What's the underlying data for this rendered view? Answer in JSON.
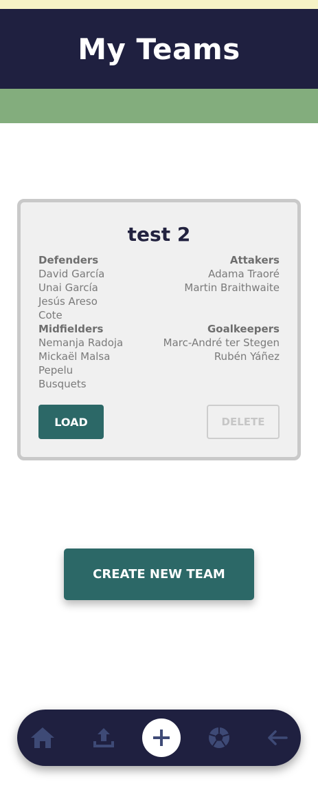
{
  "header": {
    "title": "My Teams"
  },
  "team": {
    "name": "test 2",
    "positions": {
      "defenders": {
        "title": "Defenders",
        "players": [
          "David García",
          "Unai García",
          "Jesús Areso",
          "Cote"
        ]
      },
      "midfielders": {
        "title": "Midfielders",
        "players": [
          "Nemanja Radoja",
          "Mickaël Malsa",
          "Pepelu",
          "Busquets"
        ]
      },
      "attackers": {
        "title": "Attakers",
        "players": [
          "Adama Traoré",
          "Martin Braithwaite"
        ]
      },
      "goalkeepers": {
        "title": "Goalkeepers",
        "players": [
          "Marc-André ter Stegen",
          "Rubén Yáñez"
        ]
      }
    },
    "load_label": "LOAD",
    "delete_label": "DELETE"
  },
  "create_label": "CREATE NEW TEAM",
  "nav": {
    "items": [
      "home-icon",
      "upload-icon",
      "add-icon",
      "soccer-ball-icon",
      "back-arrow-icon"
    ]
  },
  "colors": {
    "header_bg": "#1f2040",
    "top_strip": "#f6f3c6",
    "green_band": "#83ad7d",
    "primary_button": "#2c6867",
    "nav_icon": "#3e4a76"
  }
}
